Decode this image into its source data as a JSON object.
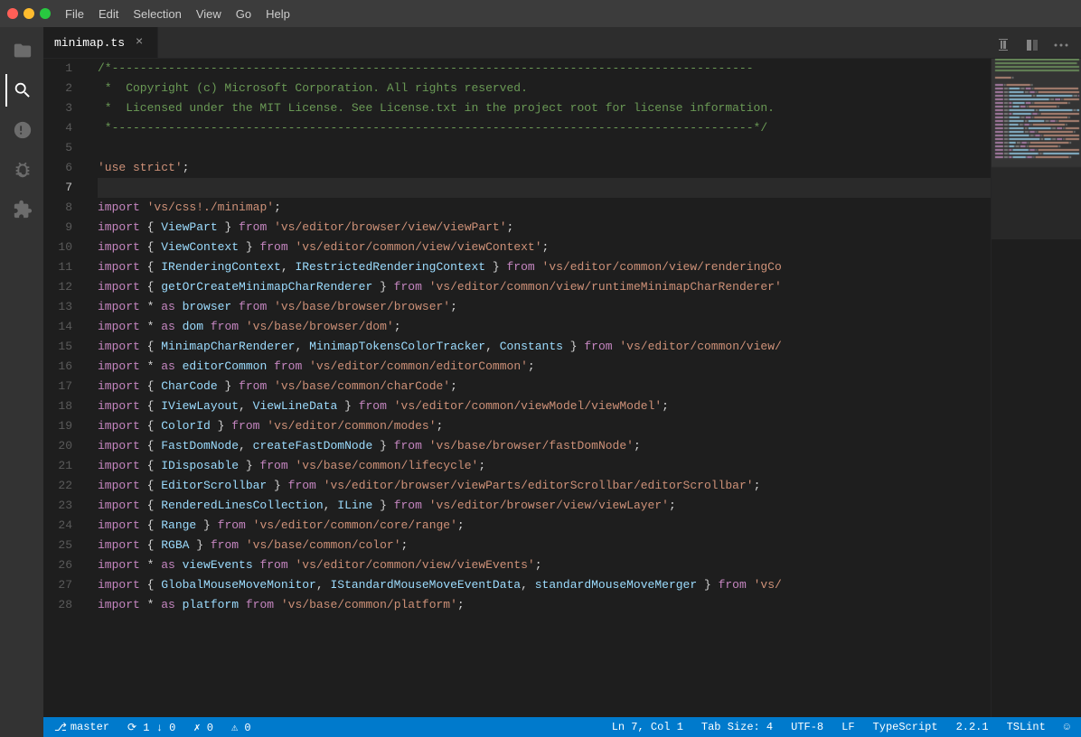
{
  "titlebar": {
    "menu": [
      "File",
      "Edit",
      "Selection",
      "View",
      "Go",
      "Help"
    ]
  },
  "tab": {
    "filename": "minimap.ts",
    "close_label": "×"
  },
  "status": {
    "branch": "master",
    "sync": "⟳ 1 ↓ 0",
    "errors": "✗ 0",
    "warnings": "⚠ 0",
    "position": "Ln 7, Col 1",
    "tab_size": "Tab Size: 4",
    "encoding": "UTF-8",
    "line_ending": "LF",
    "language": "TypeScript",
    "version": "2.2.1",
    "linter": "TSLint",
    "smiley": "☺"
  },
  "lines": [
    {
      "num": 1,
      "tokens": [
        {
          "t": "/*-------------------------------------------------------------------------------------------",
          "c": "c-comment"
        }
      ]
    },
    {
      "num": 2,
      "tokens": [
        {
          "t": " *  Copyright (c) Microsoft Corporation. All rights reserved.",
          "c": "c-comment"
        }
      ]
    },
    {
      "num": 3,
      "tokens": [
        {
          "t": " *  Licensed under the MIT License. See License.txt in the project root for license information.",
          "c": "c-comment"
        }
      ]
    },
    {
      "num": 4,
      "tokens": [
        {
          "t": " *-------------------------------------------------------------------------------------------*/",
          "c": "c-comment"
        }
      ]
    },
    {
      "num": 5,
      "tokens": []
    },
    {
      "num": 6,
      "tokens": [
        {
          "t": "'use strict'",
          "c": "c-string"
        },
        {
          "t": ";",
          "c": "c-plain"
        }
      ]
    },
    {
      "num": 7,
      "tokens": [],
      "highlighted": true
    },
    {
      "num": 8,
      "tokens": [
        {
          "t": "import",
          "c": "c-keyword"
        },
        {
          "t": " ",
          "c": "c-plain"
        },
        {
          "t": "'vs/css!./minimap'",
          "c": "c-string"
        },
        {
          "t": ";",
          "c": "c-plain"
        }
      ]
    },
    {
      "num": 9,
      "tokens": [
        {
          "t": "import",
          "c": "c-keyword"
        },
        {
          "t": " { ",
          "c": "c-plain"
        },
        {
          "t": "ViewPart",
          "c": "c-import"
        },
        {
          "t": " } ",
          "c": "c-plain"
        },
        {
          "t": "from",
          "c": "c-keyword"
        },
        {
          "t": " ",
          "c": "c-plain"
        },
        {
          "t": "'vs/editor/browser/view/viewPart'",
          "c": "c-string"
        },
        {
          "t": ";",
          "c": "c-plain"
        }
      ]
    },
    {
      "num": 10,
      "tokens": [
        {
          "t": "import",
          "c": "c-keyword"
        },
        {
          "t": " { ",
          "c": "c-plain"
        },
        {
          "t": "ViewContext",
          "c": "c-import"
        },
        {
          "t": " } ",
          "c": "c-plain"
        },
        {
          "t": "from",
          "c": "c-keyword"
        },
        {
          "t": " ",
          "c": "c-plain"
        },
        {
          "t": "'vs/editor/common/view/viewContext'",
          "c": "c-string"
        },
        {
          "t": ";",
          "c": "c-plain"
        }
      ]
    },
    {
      "num": 11,
      "tokens": [
        {
          "t": "import",
          "c": "c-keyword"
        },
        {
          "t": " { ",
          "c": "c-plain"
        },
        {
          "t": "IRenderingContext",
          "c": "c-import"
        },
        {
          "t": ", ",
          "c": "c-plain"
        },
        {
          "t": "IRestrictedRenderingContext",
          "c": "c-import"
        },
        {
          "t": " } ",
          "c": "c-plain"
        },
        {
          "t": "from",
          "c": "c-keyword"
        },
        {
          "t": " ",
          "c": "c-plain"
        },
        {
          "t": "'vs/editor/common/view/renderingCo",
          "c": "c-string"
        }
      ]
    },
    {
      "num": 12,
      "tokens": [
        {
          "t": "import",
          "c": "c-keyword"
        },
        {
          "t": " { ",
          "c": "c-plain"
        },
        {
          "t": "getOrCreateMinimapCharRenderer",
          "c": "c-import"
        },
        {
          "t": " } ",
          "c": "c-plain"
        },
        {
          "t": "from",
          "c": "c-keyword"
        },
        {
          "t": " ",
          "c": "c-plain"
        },
        {
          "t": "'vs/editor/common/view/runtimeMinimapCharRenderer'",
          "c": "c-string"
        }
      ]
    },
    {
      "num": 13,
      "tokens": [
        {
          "t": "import",
          "c": "c-keyword"
        },
        {
          "t": " * ",
          "c": "c-plain"
        },
        {
          "t": "as",
          "c": "c-keyword"
        },
        {
          "t": " browser ",
          "c": "c-import"
        },
        {
          "t": "from",
          "c": "c-keyword"
        },
        {
          "t": " ",
          "c": "c-plain"
        },
        {
          "t": "'vs/base/browser/browser'",
          "c": "c-string"
        },
        {
          "t": ";",
          "c": "c-plain"
        }
      ]
    },
    {
      "num": 14,
      "tokens": [
        {
          "t": "import",
          "c": "c-keyword"
        },
        {
          "t": " * ",
          "c": "c-plain"
        },
        {
          "t": "as",
          "c": "c-keyword"
        },
        {
          "t": " dom ",
          "c": "c-import"
        },
        {
          "t": "from",
          "c": "c-keyword"
        },
        {
          "t": " ",
          "c": "c-plain"
        },
        {
          "t": "'vs/base/browser/dom'",
          "c": "c-string"
        },
        {
          "t": ";",
          "c": "c-plain"
        }
      ]
    },
    {
      "num": 15,
      "tokens": [
        {
          "t": "import",
          "c": "c-keyword"
        },
        {
          "t": " { ",
          "c": "c-plain"
        },
        {
          "t": "MinimapCharRenderer",
          "c": "c-import"
        },
        {
          "t": ", ",
          "c": "c-plain"
        },
        {
          "t": "MinimapTokensColorTracker",
          "c": "c-import"
        },
        {
          "t": ", ",
          "c": "c-plain"
        },
        {
          "t": "Constants",
          "c": "c-import"
        },
        {
          "t": " } ",
          "c": "c-plain"
        },
        {
          "t": "from",
          "c": "c-keyword"
        },
        {
          "t": " ",
          "c": "c-plain"
        },
        {
          "t": "'vs/editor/common/view/",
          "c": "c-string"
        }
      ]
    },
    {
      "num": 16,
      "tokens": [
        {
          "t": "import",
          "c": "c-keyword"
        },
        {
          "t": " * ",
          "c": "c-plain"
        },
        {
          "t": "as",
          "c": "c-keyword"
        },
        {
          "t": " editorCommon ",
          "c": "c-import"
        },
        {
          "t": "from",
          "c": "c-keyword"
        },
        {
          "t": " ",
          "c": "c-plain"
        },
        {
          "t": "'vs/editor/common/editorCommon'",
          "c": "c-string"
        },
        {
          "t": ";",
          "c": "c-plain"
        }
      ]
    },
    {
      "num": 17,
      "tokens": [
        {
          "t": "import",
          "c": "c-keyword"
        },
        {
          "t": " { ",
          "c": "c-plain"
        },
        {
          "t": "CharCode",
          "c": "c-import"
        },
        {
          "t": " } ",
          "c": "c-plain"
        },
        {
          "t": "from",
          "c": "c-keyword"
        },
        {
          "t": " ",
          "c": "c-plain"
        },
        {
          "t": "'vs/base/common/charCode'",
          "c": "c-string"
        },
        {
          "t": ";",
          "c": "c-plain"
        }
      ]
    },
    {
      "num": 18,
      "tokens": [
        {
          "t": "import",
          "c": "c-keyword"
        },
        {
          "t": " { ",
          "c": "c-plain"
        },
        {
          "t": "IViewLayout",
          "c": "c-import"
        },
        {
          "t": ", ",
          "c": "c-plain"
        },
        {
          "t": "ViewLineData",
          "c": "c-import"
        },
        {
          "t": " } ",
          "c": "c-plain"
        },
        {
          "t": "from",
          "c": "c-keyword"
        },
        {
          "t": " ",
          "c": "c-plain"
        },
        {
          "t": "'vs/editor/common/viewModel/viewModel'",
          "c": "c-string"
        },
        {
          "t": ";",
          "c": "c-plain"
        }
      ]
    },
    {
      "num": 19,
      "tokens": [
        {
          "t": "import",
          "c": "c-keyword"
        },
        {
          "t": " { ",
          "c": "c-plain"
        },
        {
          "t": "ColorId",
          "c": "c-import"
        },
        {
          "t": " } ",
          "c": "c-plain"
        },
        {
          "t": "from",
          "c": "c-keyword"
        },
        {
          "t": " ",
          "c": "c-plain"
        },
        {
          "t": "'vs/editor/common/modes'",
          "c": "c-string"
        },
        {
          "t": ";",
          "c": "c-plain"
        }
      ]
    },
    {
      "num": 20,
      "tokens": [
        {
          "t": "import",
          "c": "c-keyword"
        },
        {
          "t": " { ",
          "c": "c-plain"
        },
        {
          "t": "FastDomNode",
          "c": "c-import"
        },
        {
          "t": ", ",
          "c": "c-plain"
        },
        {
          "t": "createFastDomNode",
          "c": "c-import"
        },
        {
          "t": " } ",
          "c": "c-plain"
        },
        {
          "t": "from",
          "c": "c-keyword"
        },
        {
          "t": " ",
          "c": "c-plain"
        },
        {
          "t": "'vs/base/browser/fastDomNode'",
          "c": "c-string"
        },
        {
          "t": ";",
          "c": "c-plain"
        }
      ]
    },
    {
      "num": 21,
      "tokens": [
        {
          "t": "import",
          "c": "c-keyword"
        },
        {
          "t": " { ",
          "c": "c-plain"
        },
        {
          "t": "IDisposable",
          "c": "c-import"
        },
        {
          "t": " } ",
          "c": "c-plain"
        },
        {
          "t": "from",
          "c": "c-keyword"
        },
        {
          "t": " ",
          "c": "c-plain"
        },
        {
          "t": "'vs/base/common/lifecycle'",
          "c": "c-string"
        },
        {
          "t": ";",
          "c": "c-plain"
        }
      ]
    },
    {
      "num": 22,
      "tokens": [
        {
          "t": "import",
          "c": "c-keyword"
        },
        {
          "t": " { ",
          "c": "c-plain"
        },
        {
          "t": "EditorScrollbar",
          "c": "c-import"
        },
        {
          "t": " } ",
          "c": "c-plain"
        },
        {
          "t": "from",
          "c": "c-keyword"
        },
        {
          "t": " ",
          "c": "c-plain"
        },
        {
          "t": "'vs/editor/browser/viewParts/editorScrollbar/editorScrollbar'",
          "c": "c-string"
        },
        {
          "t": ";",
          "c": "c-plain"
        }
      ]
    },
    {
      "num": 23,
      "tokens": [
        {
          "t": "import",
          "c": "c-keyword"
        },
        {
          "t": " { ",
          "c": "c-plain"
        },
        {
          "t": "RenderedLinesCollection",
          "c": "c-import"
        },
        {
          "t": ", ",
          "c": "c-plain"
        },
        {
          "t": "ILine",
          "c": "c-import"
        },
        {
          "t": " } ",
          "c": "c-plain"
        },
        {
          "t": "from",
          "c": "c-keyword"
        },
        {
          "t": " ",
          "c": "c-plain"
        },
        {
          "t": "'vs/editor/browser/view/viewLayer'",
          "c": "c-string"
        },
        {
          "t": ";",
          "c": "c-plain"
        }
      ]
    },
    {
      "num": 24,
      "tokens": [
        {
          "t": "import",
          "c": "c-keyword"
        },
        {
          "t": " { ",
          "c": "c-plain"
        },
        {
          "t": "Range",
          "c": "c-import"
        },
        {
          "t": " } ",
          "c": "c-plain"
        },
        {
          "t": "from",
          "c": "c-keyword"
        },
        {
          "t": " ",
          "c": "c-plain"
        },
        {
          "t": "'vs/editor/common/core/range'",
          "c": "c-string"
        },
        {
          "t": ";",
          "c": "c-plain"
        }
      ]
    },
    {
      "num": 25,
      "tokens": [
        {
          "t": "import",
          "c": "c-keyword"
        },
        {
          "t": " { ",
          "c": "c-plain"
        },
        {
          "t": "RGBA",
          "c": "c-import"
        },
        {
          "t": " } ",
          "c": "c-plain"
        },
        {
          "t": "from",
          "c": "c-keyword"
        },
        {
          "t": " ",
          "c": "c-plain"
        },
        {
          "t": "'vs/base/common/color'",
          "c": "c-string"
        },
        {
          "t": ";",
          "c": "c-plain"
        }
      ]
    },
    {
      "num": 26,
      "tokens": [
        {
          "t": "import",
          "c": "c-keyword"
        },
        {
          "t": " * ",
          "c": "c-plain"
        },
        {
          "t": "as",
          "c": "c-keyword"
        },
        {
          "t": " viewEvents ",
          "c": "c-import"
        },
        {
          "t": "from",
          "c": "c-keyword"
        },
        {
          "t": " ",
          "c": "c-plain"
        },
        {
          "t": "'vs/editor/common/view/viewEvents'",
          "c": "c-string"
        },
        {
          "t": ";",
          "c": "c-plain"
        }
      ]
    },
    {
      "num": 27,
      "tokens": [
        {
          "t": "import",
          "c": "c-keyword"
        },
        {
          "t": " { ",
          "c": "c-plain"
        },
        {
          "t": "GlobalMouseMoveMonitor",
          "c": "c-import"
        },
        {
          "t": ", ",
          "c": "c-plain"
        },
        {
          "t": "IStandardMouseMoveEventData",
          "c": "c-import"
        },
        {
          "t": ", ",
          "c": "c-plain"
        },
        {
          "t": "standardMouseMoveMerger",
          "c": "c-import"
        },
        {
          "t": " } ",
          "c": "c-plain"
        },
        {
          "t": "from",
          "c": "c-keyword"
        },
        {
          "t": " ",
          "c": "c-plain"
        },
        {
          "t": "'vs/",
          "c": "c-string"
        }
      ]
    },
    {
      "num": 28,
      "tokens": [
        {
          "t": "import",
          "c": "c-keyword"
        },
        {
          "t": " * ",
          "c": "c-plain"
        },
        {
          "t": "as",
          "c": "c-keyword"
        },
        {
          "t": " platform ",
          "c": "c-import"
        },
        {
          "t": "from",
          "c": "c-keyword"
        },
        {
          "t": " ",
          "c": "c-plain"
        },
        {
          "t": "'vs/base/common/platform'",
          "c": "c-string"
        },
        {
          "t": ";",
          "c": "c-plain"
        }
      ]
    }
  ]
}
